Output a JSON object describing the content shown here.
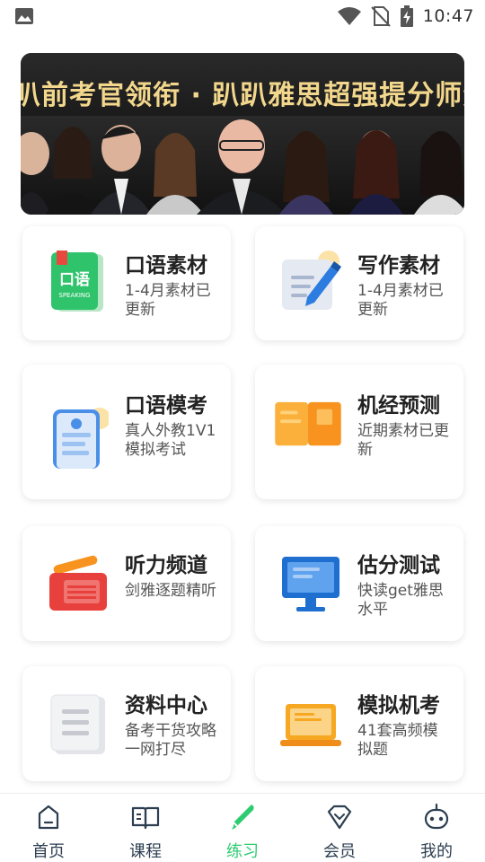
{
  "status_bar": {
    "time": "10:47",
    "icons": [
      "image-icon",
      "wifi-icon",
      "no-sim-icon",
      "battery-charging-icon"
    ]
  },
  "banner": {
    "text": "叭前考官领衔 · 趴趴雅思超强提分师资品"
  },
  "cards": [
    {
      "title": "口语素材",
      "desc": "1-4月素材已更新",
      "icon": "speaking-book-icon",
      "icon_text": "口语",
      "icon_subtext": "SPEAKING"
    },
    {
      "title": "写作素材",
      "desc": "1-4月素材已更新",
      "icon": "writing-pencil-icon"
    },
    {
      "title": "口语模考",
      "desc": "真人外教1V1模拟考试",
      "icon": "phone-chat-icon"
    },
    {
      "title": "机经预测",
      "desc": "近期素材已更新",
      "icon": "open-book-icon"
    },
    {
      "title": "听力频道",
      "desc": "剑雅逐题精听",
      "icon": "radio-icon"
    },
    {
      "title": "估分测试",
      "desc": "快读get雅思水平",
      "icon": "monitor-icon"
    },
    {
      "title": "资料中心",
      "desc": "备考干货攻略一网打尽",
      "icon": "document-icon"
    },
    {
      "title": "模拟机考",
      "desc": "41套高频模拟题",
      "icon": "laptop-icon"
    }
  ],
  "bottom_nav": [
    {
      "label": "首页",
      "icon": "home-icon",
      "active": false
    },
    {
      "label": "课程",
      "icon": "course-book-icon",
      "active": false
    },
    {
      "label": "练习",
      "icon": "practice-pen-icon",
      "active": true
    },
    {
      "label": "会员",
      "icon": "vip-diamond-icon",
      "active": false
    },
    {
      "label": "我的",
      "icon": "profile-robot-icon",
      "active": false
    }
  ],
  "colors": {
    "accent": "#2ecc71",
    "nav_text": "#2c3e50",
    "banner_text": "#f2d78c"
  }
}
